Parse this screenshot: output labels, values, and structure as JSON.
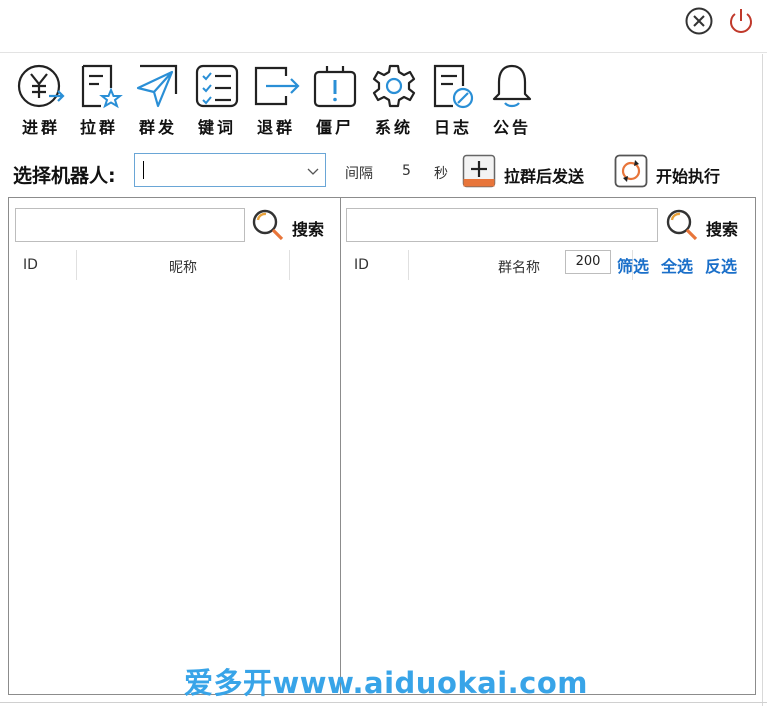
{
  "window": {
    "close_icon": "close-circle-icon",
    "power_icon": "power-icon",
    "accent_color": "#2a8fd6"
  },
  "toolbar": {
    "items": [
      {
        "label": "进群",
        "icon": "yen-enter-icon"
      },
      {
        "label": "拉群",
        "icon": "document-star-icon"
      },
      {
        "label": "群发",
        "icon": "paper-plane-icon"
      },
      {
        "label": "键词",
        "icon": "checklist-icon"
      },
      {
        "label": "退群",
        "icon": "exit-arrow-icon"
      },
      {
        "label": "僵尸",
        "icon": "battery-warning-icon"
      },
      {
        "label": "系统",
        "icon": "gear-icon"
      },
      {
        "label": "日志",
        "icon": "log-edit-icon"
      },
      {
        "label": "公告",
        "icon": "bell-icon"
      }
    ]
  },
  "robot_bar": {
    "label": "选择机器人:",
    "select_value": "",
    "interval_label": "间隔",
    "interval_value": "5",
    "interval_unit": "秒",
    "pull_send_label": "拉群后发送",
    "start_label": "开始执行"
  },
  "left_panel": {
    "search_value": "",
    "search_label": "搜索",
    "columns": [
      "ID",
      "昵称"
    ],
    "rows": []
  },
  "right_panel": {
    "search_value": "",
    "search_label": "搜索",
    "columns": [
      "ID",
      "群名称"
    ],
    "count_value": "200",
    "filter_label": "筛选",
    "select_all_label": "全选",
    "invert_label": "反选",
    "rows": []
  },
  "watermark": "爱多开www.aiduokai.com"
}
